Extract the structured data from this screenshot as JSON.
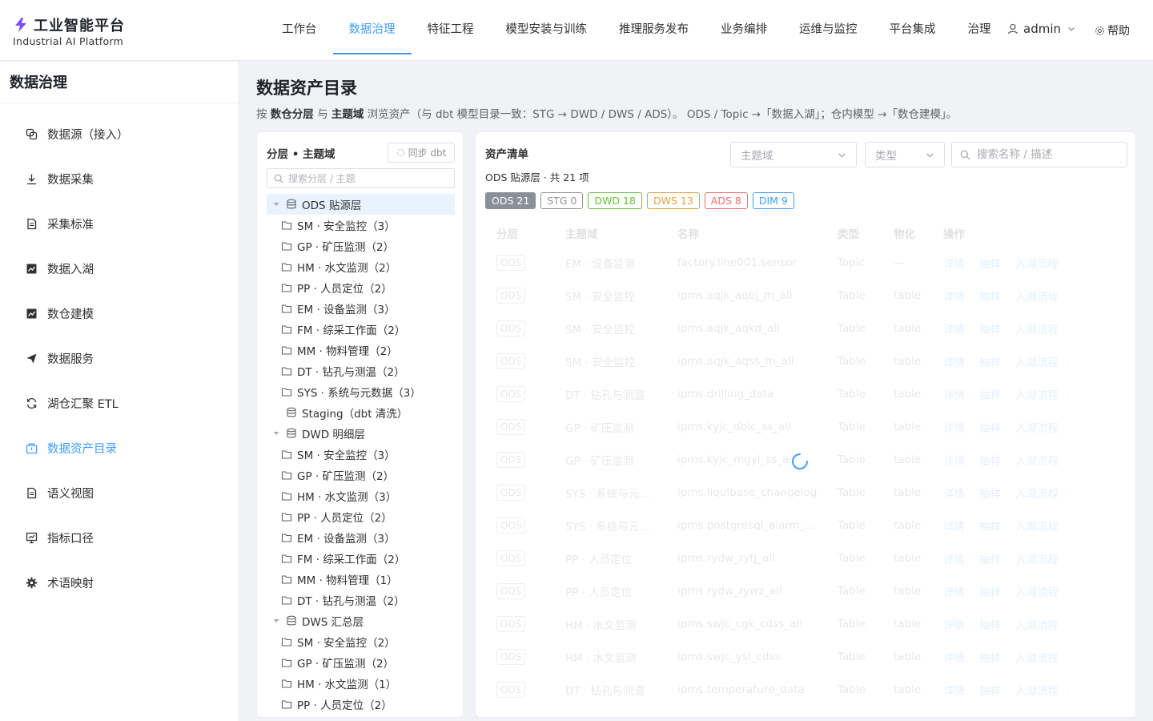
{
  "brand": {
    "title": "工业智能平台",
    "subtitle": "Industrial AI Platform"
  },
  "topnav": [
    {
      "label": "工作台"
    },
    {
      "label": "数据治理"
    },
    {
      "label": "特征工程"
    },
    {
      "label": "模型安装与训练"
    },
    {
      "label": "推理服务发布"
    },
    {
      "label": "业务编排"
    },
    {
      "label": "运维与监控"
    },
    {
      "label": "平台集成"
    },
    {
      "label": "治理与"
    }
  ],
  "user": {
    "name": "admin",
    "help": "帮助"
  },
  "sidebar": {
    "title": "数据治理",
    "items": [
      {
        "label": "数据源（接入）"
      },
      {
        "label": "数据采集"
      },
      {
        "label": "采集标准"
      },
      {
        "label": "数据入湖"
      },
      {
        "label": "数仓建模"
      },
      {
        "label": "数据服务"
      },
      {
        "label": "湖仓汇聚 ETL"
      },
      {
        "label": "数据资产目录"
      },
      {
        "label": "语义视图"
      },
      {
        "label": "指标口径"
      },
      {
        "label": "术语映射"
      }
    ]
  },
  "page": {
    "title": "数据资产目录",
    "desc_1": "按 ",
    "desc_b1": "数仓分层",
    "desc_2": " 与 ",
    "desc_b2": "主题域",
    "desc_3": " 浏览资产（与 dbt 模型目录一致：STG → DWD / DWS / ADS）。 ODS / Topic →「数据入湖」；仓内模型 →「数仓建模」。"
  },
  "tree_panel": {
    "title": "分层 • 主题域",
    "sync_label": "同步 dbt",
    "search_placeholder": "搜索分层 / 主题",
    "nodes": {
      "ods": {
        "label": "ODS 贴源层",
        "children": [
          "SM · 安全监控（3）",
          "GP · 矿压监测（2）",
          "HM · 水文监测（2）",
          "PP · 人员定位（2）",
          "EM · 设备监测（3）",
          "FM · 综采工作面（2）",
          "MM · 物料管理（2）",
          "DT · 钻孔与测温（2）",
          "SYS · 系统与元数据（3）"
        ]
      },
      "stg": {
        "label": "Staging（dbt 清洗）"
      },
      "dwd": {
        "label": "DWD 明细层",
        "children": [
          "SM · 安全监控（3）",
          "GP · 矿压监测（2）",
          "HM · 水文监测（3）",
          "PP · 人员定位（2）",
          "EM · 设备监测（3）",
          "FM · 综采工作面（2）",
          "MM · 物料管理（1）",
          "DT · 钻孔与测温（2）"
        ]
      },
      "dws": {
        "label": "DWS 汇总层",
        "children": [
          "SM · 安全监控（2）",
          "GP · 矿压监测（2）",
          "HM · 水文监测（1）",
          "PP · 人员定位（2）"
        ]
      }
    }
  },
  "asset_panel": {
    "title": "资产清单",
    "subtitle": "ODS 贴源层 · 共 21 项",
    "domain_placeholder": "主题域",
    "type_placeholder": "类型",
    "search_placeholder": "搜索名称 / 描述",
    "chips": [
      {
        "label": "ODS 21",
        "color": "#8a8f99",
        "filled": true
      },
      {
        "label": "STG 0",
        "color": "#909399",
        "filled": false
      },
      {
        "label": "DWD 18",
        "color": "#67c23a",
        "filled": false
      },
      {
        "label": "DWS 13",
        "color": "#e6a23c",
        "filled": false
      },
      {
        "label": "ADS 8",
        "color": "#f56c6c",
        "filled": false
      },
      {
        "label": "DIM 9",
        "color": "#409eff",
        "filled": false
      }
    ],
    "columns": [
      "分层",
      "主题域",
      "名称",
      "类型",
      "物化",
      "操作"
    ],
    "rows": [
      {
        "layer": "ODS",
        "domain": "EM · 设备监测",
        "name": "factory.line001.sensor",
        "type": "Topic",
        "mat": "—"
      },
      {
        "layer": "ODS",
        "domain": "SM · 安全监控",
        "name": "ipms.aqjk_aqbj_m_all",
        "type": "Table",
        "mat": "table"
      },
      {
        "layer": "ODS",
        "domain": "SM · 安全监控",
        "name": "ipms.aqjk_aqkd_all",
        "type": "Table",
        "mat": "table"
      },
      {
        "layer": "ODS",
        "domain": "SM · 安全监控",
        "name": "ipms.aqjk_aqss_m_all",
        "type": "Table",
        "mat": "table"
      },
      {
        "layer": "ODS",
        "domain": "DT · 钻孔与测温",
        "name": "ipms.drilling_data",
        "type": "Table",
        "mat": "table"
      },
      {
        "layer": "ODS",
        "domain": "GP · 矿压监测",
        "name": "ipms.kyjc_dblc_ss_all",
        "type": "Table",
        "mat": "table"
      },
      {
        "layer": "ODS",
        "domain": "GP · 矿压监测",
        "name": "ipms.kyjc_mgyl_ss_all",
        "type": "Table",
        "mat": "table"
      },
      {
        "layer": "ODS",
        "domain": "SYS · 系统与元...",
        "name": "ipms.liquibase_changelog",
        "type": "Table",
        "mat": "table"
      },
      {
        "layer": "ODS",
        "domain": "SYS · 系统与元...",
        "name": "ipms.postgresql_alarm_...",
        "type": "Table",
        "mat": "table"
      },
      {
        "layer": "ODS",
        "domain": "PP · 人员定位",
        "name": "ipms.rydw_rytj_all",
        "type": "Table",
        "mat": "table"
      },
      {
        "layer": "ODS",
        "domain": "PP · 人员定位",
        "name": "ipms.rydw_rywz_all",
        "type": "Table",
        "mat": "table"
      },
      {
        "layer": "ODS",
        "domain": "HM · 水文监测",
        "name": "ipms.swjc_cgk_cdss_all",
        "type": "Table",
        "mat": "table"
      },
      {
        "layer": "ODS",
        "domain": "HM · 水文监测",
        "name": "ipms.swjc_ysl_cdss",
        "type": "Table",
        "mat": "table"
      },
      {
        "layer": "ODS",
        "domain": "DT · 钻孔与测温",
        "name": "ipms.temperature_data",
        "type": "Table",
        "mat": "table"
      }
    ],
    "ops": [
      "详情",
      "抽样",
      "入湖流程"
    ]
  }
}
